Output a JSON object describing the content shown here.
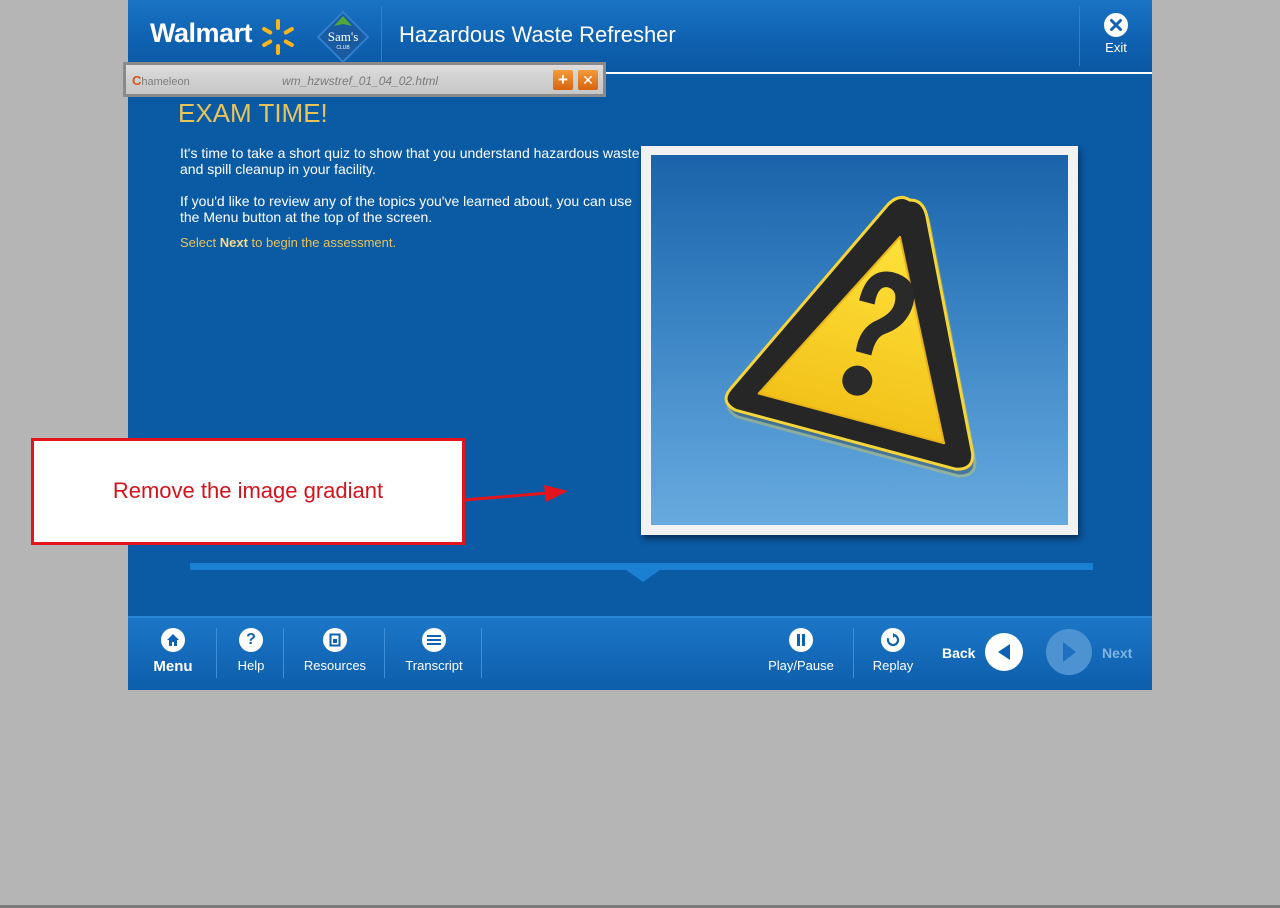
{
  "header": {
    "brand": "Walmart",
    "sams_logo_text": "Sam's",
    "sams_logo_sub": "CLUB",
    "course_title": "Hazardous Waste Refresher",
    "exit_label": "Exit"
  },
  "chameleon": {
    "logo_text": "hameleon",
    "logo_initial": "C",
    "file_name": "wm_hzwstref_01_04_02.html",
    "add_glyph": "+",
    "close_glyph": "✕"
  },
  "content": {
    "title": "EXAM TIME!",
    "paragraph_1": "It's time to take a short quiz to show that you understand hazardous waste and spill cleanup in your facility.",
    "paragraph_2": "If you'd like to review any of the topics you've learned about, you can use the Menu button at the top of the screen.",
    "select_prefix": "Select ",
    "select_bold": "Next",
    "select_suffix": " to begin the assessment.",
    "image_icon": "warning-question-icon"
  },
  "footer": {
    "menu": "Menu",
    "help": "Help",
    "resources": "Resources",
    "transcript": "Transcript",
    "play_pause": "Play/Pause",
    "replay": "Replay",
    "back": "Back",
    "next": "Next"
  },
  "annotation": {
    "text": "Remove the image gradiant"
  },
  "colors": {
    "course_blue": "#0b5aa4",
    "title_gold": "#e8c35a",
    "annotation_red": "#e3141b",
    "background_gray": "#b5b5b5"
  }
}
